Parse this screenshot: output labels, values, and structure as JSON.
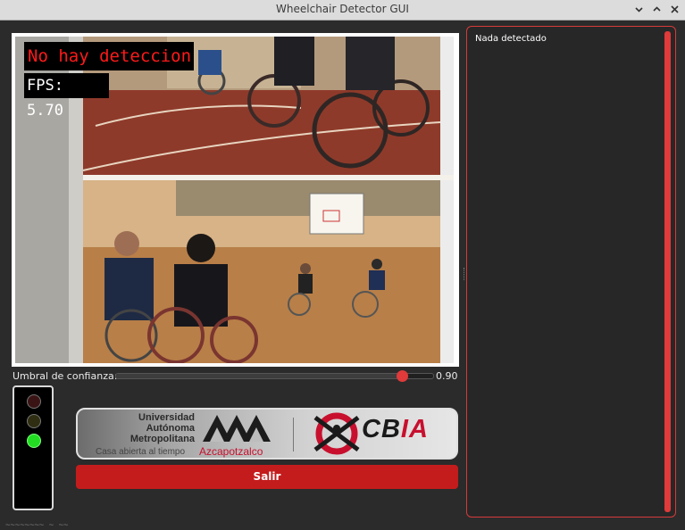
{
  "window": {
    "title": "Wheelchair Detector GUI",
    "controls": [
      "chevron-down-icon",
      "chevron-up-icon",
      "close-icon"
    ]
  },
  "video": {
    "status_text": "No hay deteccion",
    "fps_text": "FPS: 5.70",
    "status_color": "#ff1a1a"
  },
  "threshold": {
    "label": "Umbral de confianza:",
    "value": 0.9,
    "value_text": "0.90"
  },
  "semaphore": {
    "lights": [
      {
        "name": "red-light",
        "state": "off",
        "color": "#3a1414"
      },
      {
        "name": "yellow-light",
        "state": "off",
        "color": "#2f2e12"
      },
      {
        "name": "green-light",
        "state": "on",
        "color": "#22dd22"
      }
    ]
  },
  "logo": {
    "uam_lines": [
      "Universidad",
      "Autónoma",
      "Metropolitana"
    ],
    "uam_motto": "Casa abierta al tiempo",
    "uam_campus": "Azcapotzalco",
    "cbia_prefix": "CB",
    "cbia_suffix": "IA"
  },
  "exit_button": {
    "label": "Salir",
    "color": "#c41c1c"
  },
  "detections_panel": {
    "text": "Nada detectado",
    "accent": "#d83a3a"
  },
  "footer": {
    "text": "~~~~~~~~ ~ ~~"
  }
}
